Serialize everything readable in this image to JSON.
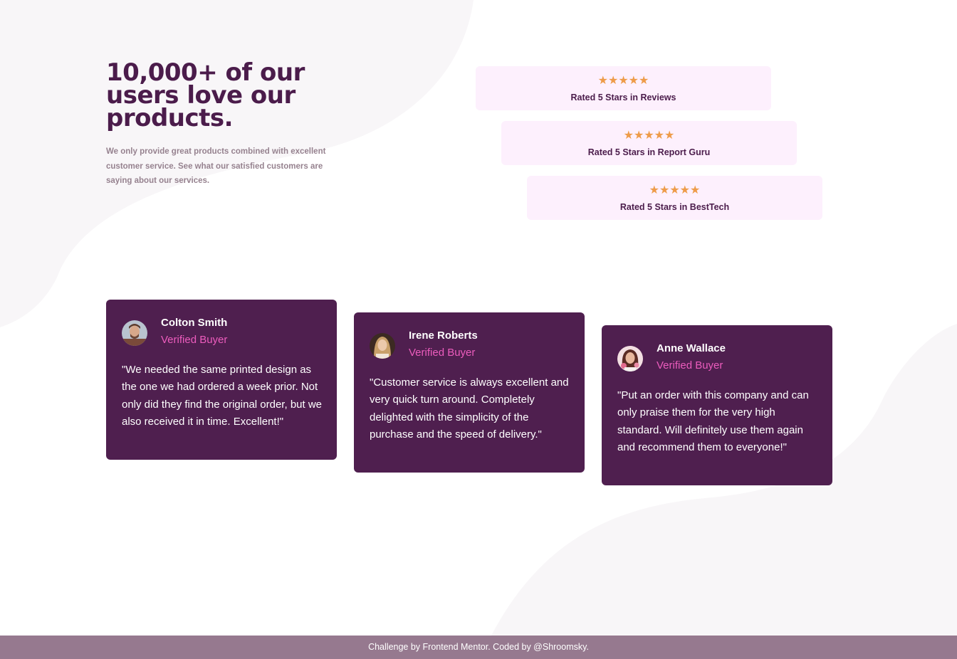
{
  "hero": {
    "title": "10,000+ of our users love our products.",
    "description": "We only provide great products combined with excellent customer service. See what our satisfied customers are saying about our services."
  },
  "ratings": [
    {
      "stars": "★★★★★",
      "label": "Rated 5 Stars in Reviews"
    },
    {
      "stars": "★★★★★",
      "label": "Rated 5 Stars in Report Guru"
    },
    {
      "stars": "★★★★★",
      "label": "Rated 5 Stars in BestTech"
    }
  ],
  "testimonials": [
    {
      "name": "Colton Smith",
      "role": "Verified Buyer",
      "quote": "\"We needed the same printed design as the one we had ordered a week prior. Not only did they find the original order, but we also received it in time. Excellent!\""
    },
    {
      "name": "Irene Roberts",
      "role": "Verified Buyer",
      "quote": "\"Customer service is always excellent and very quick turn around. Completely delighted with the simplicity of the purchase and the speed of delivery.\""
    },
    {
      "name": "Anne Wallace",
      "role": "Verified Buyer",
      "quote": "\"Put an order with this company and can only praise them for the very high standard. Will definitely use them again and recommend them to everyone!\""
    }
  ],
  "footer": {
    "text": "Challenge by Frontend Mentor. Coded by @Shroomsky."
  },
  "colors": {
    "heading": "#4b1c4b",
    "card_background": "#4f1f4f",
    "rating_background": "#fdf0fd",
    "star": "#ee9c4a",
    "accent_pink": "#ec5cbd",
    "footer_background": "#96798f"
  }
}
